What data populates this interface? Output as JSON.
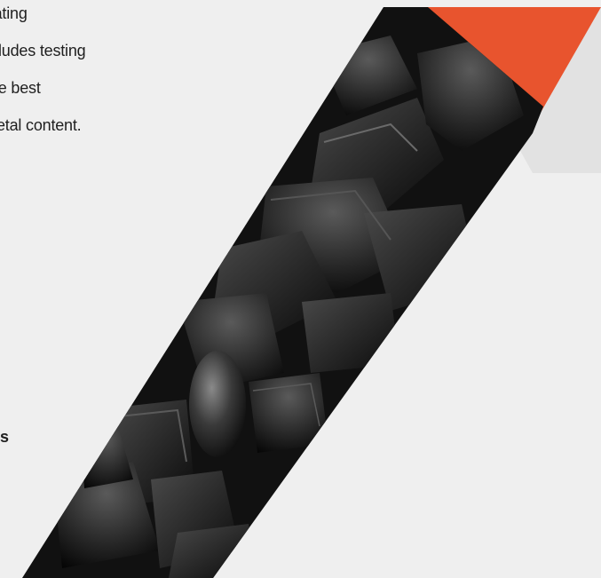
{
  "body": {
    "lines": [
      "reating",
      "ludes testing",
      "he best",
      "etal content."
    ]
  },
  "bold_fragment": "s",
  "colors": {
    "background": "#efefef",
    "accent": "#e8542e",
    "shadow_panel": "#e1e1e1",
    "coal": "#1a1a1a"
  }
}
